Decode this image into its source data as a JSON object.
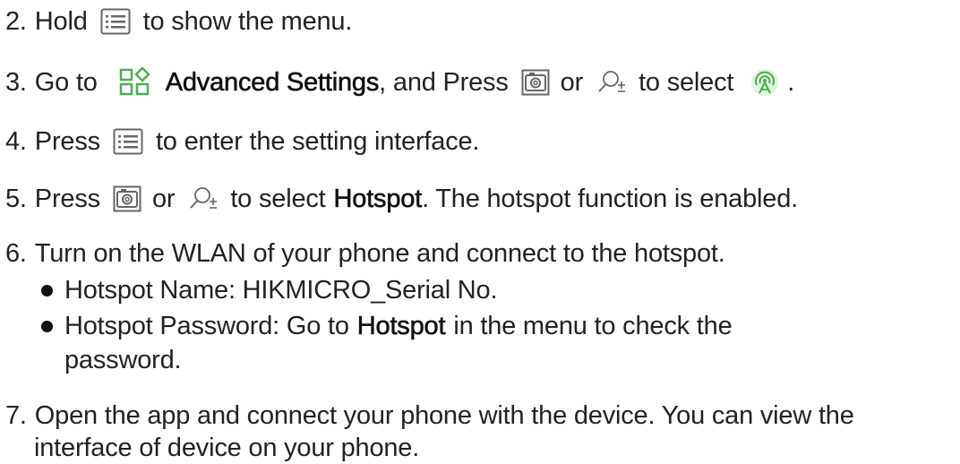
{
  "steps": {
    "s2": {
      "number": "2.",
      "before": "Hold",
      "after": "to show the menu.",
      "icon": "menu-icon"
    },
    "s3": {
      "number": "3.",
      "go_to": "Go to",
      "settings_label": "Advanced Settings",
      "and_press": ", and Press",
      "or": "or",
      "to_select": "to select",
      "end": ".",
      "icons": [
        "advanced-settings-icon",
        "camera-icon",
        "zoom-icon",
        "hotspot-icon"
      ],
      "accent_color": "#4caf50"
    },
    "s4": {
      "number": "4.",
      "before": "Press",
      "after": "to enter the setting interface.",
      "icon": "menu-icon"
    },
    "s5": {
      "number": "5.",
      "before": "Press",
      "or": "or",
      "to_select": "to select",
      "hotspot": "Hotspot",
      "after": ". The hotspot function is enabled.",
      "icons": [
        "camera-icon",
        "zoom-icon"
      ]
    },
    "s6": {
      "number": "6.",
      "text": "Turn on the WLAN of your phone and connect to the hotspot.",
      "bullets": {
        "name": "Hotspot Name: HIKMICRO_Serial No.",
        "password_before": "Hotspot Password: Go to",
        "password_hotspot": "Hotspot",
        "password_after": "in the menu to check the",
        "password_cont": "password."
      }
    },
    "s7": {
      "number": "7.",
      "line1": "Open the app and connect your phone with the device. You can view the",
      "line2": "interface of device on your phone."
    }
  }
}
